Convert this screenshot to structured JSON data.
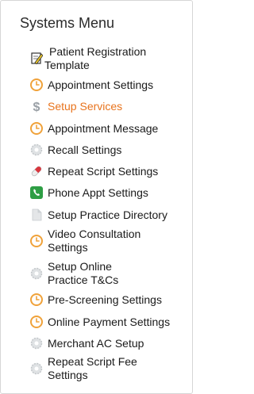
{
  "menu": {
    "title": "Systems Menu",
    "items": [
      {
        "label_lines": [
          "Patient Registration",
          "Template"
        ],
        "icon": "edit-note-icon"
      },
      {
        "label_lines": [
          "Appointment Settings"
        ],
        "icon": "clock-icon"
      },
      {
        "label_lines": [
          "Setup Services"
        ],
        "icon": "dollar-icon",
        "active": true
      },
      {
        "label_lines": [
          "Appointment Message"
        ],
        "icon": "clock-icon"
      },
      {
        "label_lines": [
          "Recall Settings"
        ],
        "icon": "gear-icon"
      },
      {
        "label_lines": [
          "Repeat Script Settings"
        ],
        "icon": "pill-icon"
      },
      {
        "label_lines": [
          "Phone Appt Settings"
        ],
        "icon": "phone-icon"
      },
      {
        "label_lines": [
          "Setup Practice Directory"
        ],
        "icon": "document-icon"
      },
      {
        "label_lines": [
          "Video Consultation",
          "Settings"
        ],
        "icon": "clock-icon"
      },
      {
        "label_lines": [
          "Setup Online",
          "Practice T&Cs"
        ],
        "icon": "gear-icon"
      },
      {
        "label_lines": [
          "Pre-Screening Settings"
        ],
        "icon": "clock-icon"
      },
      {
        "label_lines": [
          "Online Payment Settings"
        ],
        "icon": "clock-icon"
      },
      {
        "label_lines": [
          "Merchant AC Setup"
        ],
        "icon": "gear-icon"
      },
      {
        "label_lines": [
          "Repeat Script Fee",
          "Settings"
        ],
        "icon": "gear-icon"
      }
    ]
  },
  "colors": {
    "active_text": "#e8731c",
    "clock": "#f0a23a",
    "gear": "#cfd3d6",
    "phone": "#2e9e44",
    "pill": "#d9363e",
    "dollar": "#9aa0a6"
  }
}
